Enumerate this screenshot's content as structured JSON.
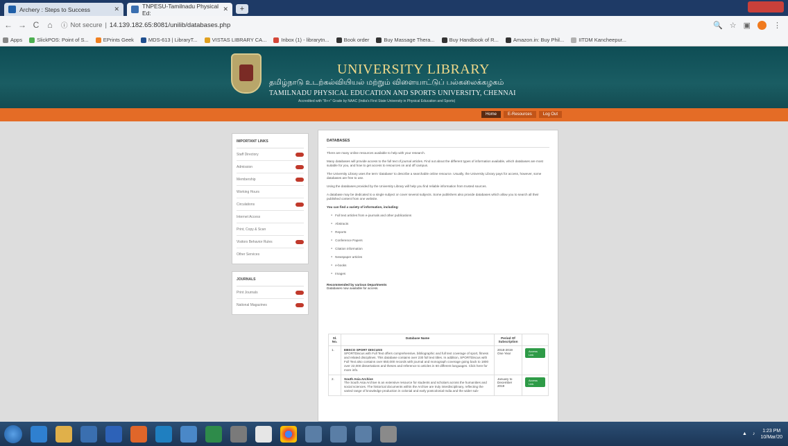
{
  "browser": {
    "tabs": [
      {
        "title": "Archery : Steps to Success",
        "favicon_color": "#1f5fa8"
      },
      {
        "title": "TNPESU-Tamilnadu Physical Ed:",
        "favicon_color": "#3a6fb0"
      }
    ],
    "new_tab": "+",
    "not_secure_label": "Not secure",
    "url": "14.139.182.65:8081/unilib/databases.php",
    "bookmarks": [
      "Apps",
      "SlickPOS: Point of S...",
      "EPrints Geek",
      "MDS-613 | LibraryT...",
      "VISTAS LIBRARY CA...",
      "Inbox (1) - librarytn...",
      "Book order",
      "Buy Massage Thera...",
      "Buy Handbook of R...",
      "Amazon.in: Buy Phil...",
      "IITDM Kancheepur..."
    ]
  },
  "header": {
    "title": "UNIVERSITY LIBRARY",
    "tamil_name": "தமிழ்நாடு உடற்கல்வியியல் மற்றும் விளையாட்டுப் பல்கலைக்கழகம்",
    "english_name": "TAMILNADU PHYSICAL EDUCATION AND SPORTS UNIVERSITY, CHENNAI",
    "accreditation": "Accredited with \"B++\" Grade by NAAC (India's First State University in Physical Education and Sports)",
    "nav": [
      "Home",
      "E-Resources",
      "Log Out"
    ]
  },
  "sidebar": {
    "important_links_title": "IMPORTANT LINKS",
    "important_links": [
      {
        "label": "Staff Directory",
        "badge": true
      },
      {
        "label": "Admission",
        "badge": true
      },
      {
        "label": "Membership",
        "badge": true
      },
      {
        "label": "Working Hours",
        "badge": false
      },
      {
        "label": "Circulations",
        "badge": true
      },
      {
        "label": "Internet Access",
        "badge": false
      },
      {
        "label": "Print, Copy & Scan",
        "badge": false
      },
      {
        "label": "Visitors Behavior Rules",
        "badge": true
      },
      {
        "label": "Other Services",
        "badge": false
      }
    ],
    "journals_title": "JOURNALS",
    "journals": [
      {
        "label": "Print Journals",
        "badge": true
      },
      {
        "label": "National Magazines",
        "badge": true
      }
    ]
  },
  "content": {
    "title": "DATABASES",
    "paragraphs": [
      "There are many online resources available to help with your research.",
      "Many databases will provide access to the full text of journal articles. Find out about the different types of information available, which databases are most suitable for you, and how to get access to resources on and off campus.",
      "The University Library uses the term 'database' to describe a searchable online resource. Usually, the University Library pays for access, however, some databases are free to use.",
      "Using the databases provided by the University Library will help you find reliable information from trusted sources.",
      "A database may be dedicated to a single subject or cover several subjects. Some publishers also provide databases which allow you to search all their published content from one website."
    ],
    "list_heading": "You can find a variety of information, including:",
    "list_items": [
      "Full text articles from e-journals and other publications",
      "Abstracts",
      "Reports",
      "Conference Papers",
      "Citation information",
      "Newspaper articles",
      "e-books",
      "Images"
    ],
    "recommended_heading": "Recommended by various Departments",
    "recommended_sub": "Databases now available for access.",
    "table": {
      "headers": {
        "sl": "Sl. No.",
        "name": "Database Name",
        "period": "Period Of Subscription"
      },
      "rows": [
        {
          "sl": "1.",
          "name": "EBSCO SPORT DISCUSS",
          "desc": "SPORTDiscus with Full Text offers comprehensive, bibliographic and full text coverage of sport, fitness and related disciplines. This database contains over 230 full text titles. In addition, SPORTDiscus with Full Text also contains over 650,000 records with journal and monograph coverage going back to 1800 over 22,000 dissertations and theses and reference to articles in 60 different languages. Click here for more info.",
          "period": "2018-2019 One Year",
          "action": "Access Link"
        },
        {
          "sl": "2.",
          "name": "South Asia Archive",
          "desc": "The South Asia Archive is an extensive resource for students and scholars across the humanities and social sciences. The historical documents within the Archive are truly interdisciplinary, reflecting the varied range of knowledge production in colonial and early postcolonial India and the wider sub-",
          "period": "January to December 2019",
          "action": "Access Link"
        }
      ]
    }
  },
  "taskbar": {
    "time": "1:23 PM",
    "date": "10/Mar/20"
  }
}
